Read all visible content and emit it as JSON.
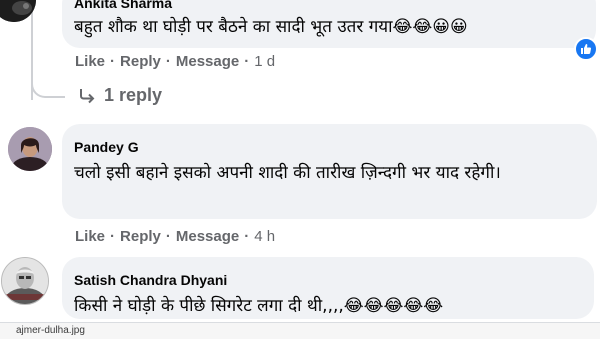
{
  "comments": [
    {
      "author": "Ankita Sharma",
      "text": "बहुत शौक था घोड़ी पर बैठने का सादी भूत उतर गया😂😂😀😀",
      "like": "Like",
      "reply": "Reply",
      "message": "Message",
      "time": "1 d",
      "replies_label": "1 reply"
    },
    {
      "author": "Pandey G",
      "text": "चलो इसी बहाने इसको अपनी शादी की तारीख ज़िन्दगी भर याद रहेगी।",
      "like": "Like",
      "reply": "Reply",
      "message": "Message",
      "time": "4 h"
    },
    {
      "author": "Satish Chandra Dhyani",
      "text": "किसी ने घोड़ी के पीछे सिगरेट लगा दी थी,,,,😂😂😂😂😂"
    }
  ],
  "download_bar": {
    "filename": "ajmer-dulha.jpg"
  },
  "colors": {
    "bubble": "#f0f2f5",
    "meta_text": "#65676b",
    "like_blue": "#1877f2"
  }
}
